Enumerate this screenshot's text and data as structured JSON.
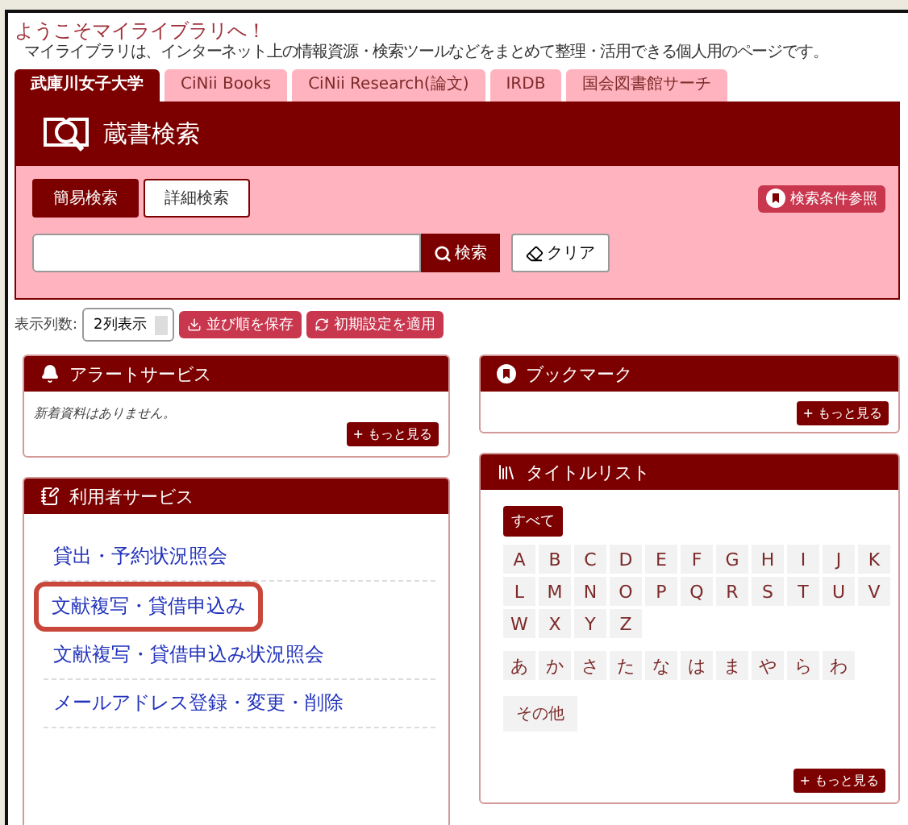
{
  "header": {
    "title": "ようこそマイライブラリへ！",
    "description": "マイライブラリは、インターネット上の情報資源・検索ツールなどをまとめて整理・活用できる個人用のページです。"
  },
  "tabs": [
    {
      "label": "武庫川女子大学",
      "selected": true
    },
    {
      "label": "CiNii Books",
      "selected": false
    },
    {
      "label": "CiNii Research(論文)",
      "selected": false
    },
    {
      "label": "IRDB",
      "selected": false
    },
    {
      "label": "国会図書館サーチ",
      "selected": false
    }
  ],
  "search_panel": {
    "title": "蔵書検索",
    "modes": [
      {
        "label": "簡易検索",
        "selected": true
      },
      {
        "label": "詳細検索",
        "selected": false
      }
    ],
    "reference_button": "検索条件参照",
    "search_button": "検索",
    "clear_button": "クリア"
  },
  "display_settings": {
    "label": "表示列数:",
    "columns_select": "2列表示",
    "save_order_button": "並び順を保存",
    "reset_button": "初期設定を適用"
  },
  "alert_service": {
    "title": "アラートサービス",
    "message": "新着資料はありません。",
    "more_button": "+ もっと見る"
  },
  "user_services": {
    "title": "利用者サービス",
    "links": [
      {
        "label": "貸出・予約状況照会",
        "highlighted": false
      },
      {
        "label": "文献複写・貸借申込み",
        "highlighted": true
      },
      {
        "label": "文献複写・貸借申込み状況照会",
        "highlighted": false
      },
      {
        "label": "メールアドレス登録・変更・削除",
        "highlighted": false
      }
    ]
  },
  "bookmark": {
    "title": "ブックマーク",
    "more_button": "+ もっと見る"
  },
  "title_list": {
    "title": "タイトルリスト",
    "all_button": {
      "label": "すべて",
      "selected": true
    },
    "letters": [
      "A",
      "B",
      "C",
      "D",
      "E",
      "F",
      "G",
      "H",
      "I",
      "J",
      "K",
      "L",
      "M",
      "N",
      "O",
      "P",
      "Q",
      "R",
      "S",
      "T",
      "U",
      "V",
      "W",
      "X",
      "Y",
      "Z"
    ],
    "kana": [
      "あ",
      "か",
      "さ",
      "た",
      "な",
      "は",
      "ま",
      "や",
      "ら",
      "わ"
    ],
    "other": "その他",
    "more_button": "+ もっと見る"
  }
}
